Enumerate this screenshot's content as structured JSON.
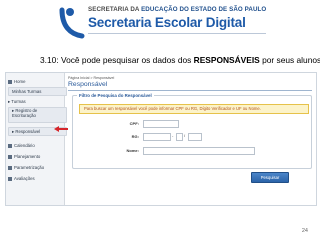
{
  "header": {
    "org_line_prefix": "SECRETARIA DA ",
    "org_line_bold": "EDUCAÇÃO DO ESTADO DE SÃO PAULO",
    "app_name": "Secretaria Escolar Digital"
  },
  "instruction": {
    "prefix": "3.10: Você pode pesquisar os dados dos ",
    "bold": "RESPONSÁVEIS",
    "suffix": " por seus alunos:"
  },
  "screenshot": {
    "breadcrumb": "Página Inicial > Responsável",
    "page_title": "Responsável",
    "sidebar": {
      "items": [
        {
          "label": "Home",
          "icon": "home-icon"
        },
        {
          "label": "Minhas Turmas",
          "icon": ""
        },
        {
          "label": "▸ Turmas",
          "icon": ""
        },
        {
          "label": "▸ Registro de Escrituração",
          "icon": ""
        },
        {
          "label": "▸ Responsável",
          "icon": ""
        },
        {
          "label": "Calendário",
          "icon": "calendar-icon"
        },
        {
          "label": "Planejamento",
          "icon": "planning-icon"
        },
        {
          "label": "Parametrização",
          "icon": "settings-icon"
        },
        {
          "label": "Avaliações",
          "icon": "evaluations-icon"
        }
      ]
    },
    "filter": {
      "legend": "Filtro de Pesquisa do Responsável",
      "warning": "Para buscar um responsável você pode informar CPF ou RG, Dígito Verificador e UF ou Nome.",
      "cpf_label": "CPF:",
      "rg_label": "RG:",
      "rg_separator": "-",
      "rg_uf_separator": "/",
      "name_label": "Nome:",
      "cpf_value": "",
      "rg_value": "",
      "rg_digit_value": "",
      "uf_value": "",
      "name_value": "",
      "search_button": "Pesquisar"
    }
  },
  "page_number": "24",
  "colors": {
    "brand_blue": "#1e5aa8",
    "warning_bg": "#fcf3c9",
    "warning_text": "#b3541e",
    "arrow_red": "#d6262b"
  }
}
